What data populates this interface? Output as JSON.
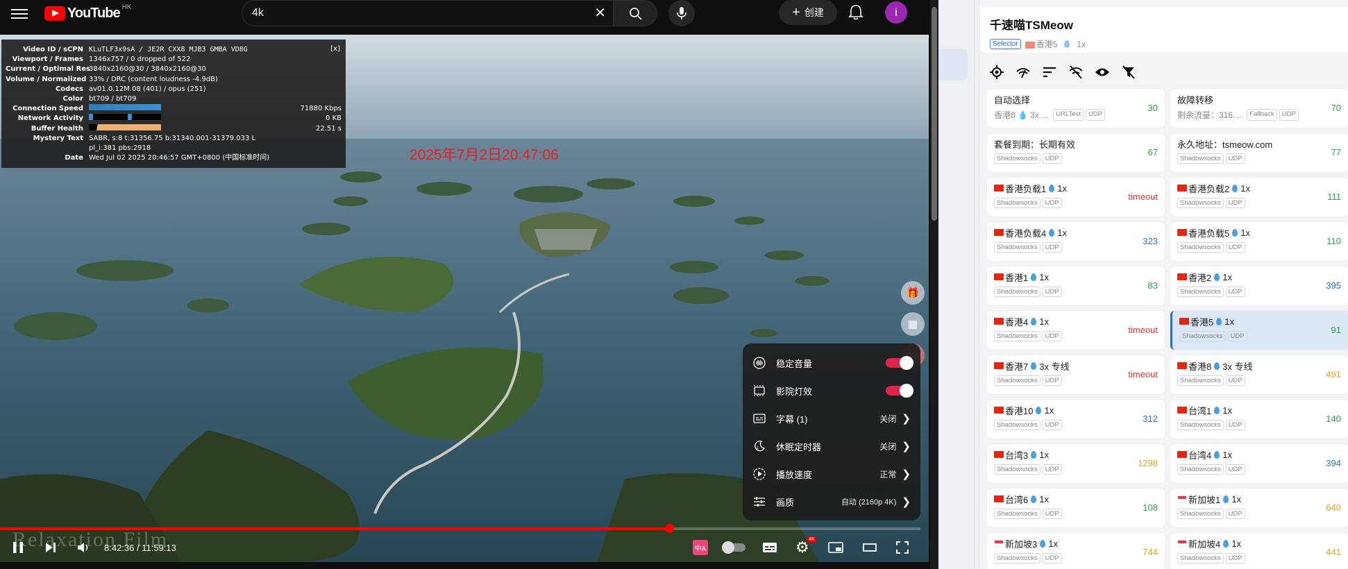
{
  "youtube": {
    "logo_text": "YouTube",
    "region": "HK",
    "search_value": "4k",
    "clear_glyph": "✕",
    "create_label": "创建",
    "avatar_letter": "i",
    "timestamp_overlay": "2025年7月2日20:47:06",
    "watermark": "Relaxation Film",
    "stats": {
      "close": "[x]",
      "rows": [
        {
          "label": "Video ID / sCPN",
          "value": "KLuTLF3x9sA / JE2R CXX8 MJB3 GMBA VD8G"
        },
        {
          "label": "Viewport / Frames",
          "value": "1346x757 / 0 dropped of 522"
        },
        {
          "label": "Current / Optimal Res",
          "value": "3840x2160@30 / 3840x2160@30"
        },
        {
          "label": "Volume / Normalized",
          "value": "33% / DRC (content loudness -4.9dB)"
        },
        {
          "label": "Codecs",
          "value": "av01.0.12M.08 (401) / opus (251)"
        },
        {
          "label": "Color",
          "value": "bt709 / bt709"
        },
        {
          "label": "Connection Speed",
          "value": "71880 Kbps"
        },
        {
          "label": "Network Activity",
          "value": "0 KB"
        },
        {
          "label": "Buffer Health",
          "value": "22.51 s"
        },
        {
          "label": "Mystery Text",
          "value": "SABR, s:8 t:31356.75 b:31340.001-31379.033 L"
        },
        {
          "label": "",
          "value": "pl_i:381 pbs:2918"
        },
        {
          "label": "Date",
          "value": "Wed Jul 02 2025 20:46:57 GMT+0800 (中国标准时间)"
        }
      ]
    },
    "settings": [
      {
        "label": "稳定音量",
        "value": "",
        "toggle": true
      },
      {
        "label": "影院灯效",
        "value": "",
        "toggle": true
      },
      {
        "label": "字幕 (1)",
        "value": "关闭"
      },
      {
        "label": "休眠定时器",
        "value": "关闭"
      },
      {
        "label": "播放速度",
        "value": "正常"
      },
      {
        "label": "画质",
        "value": "自动 (2160p 4K)"
      }
    ],
    "player": {
      "time": "8:42:36 / 11:59:13",
      "progress": 0.727,
      "quality_badge": "4K"
    }
  },
  "clash": {
    "group_name": "千速喵TSMeow",
    "group_type": "Selector",
    "group_current": "香港5",
    "group_rate": "1x",
    "nodes": [
      {
        "name": "自动选择",
        "sub": "香港8 💧 3x ...",
        "tags": [
          "URLTest",
          "UDP"
        ],
        "latency": "30",
        "lc": "g",
        "flag": "none",
        "subline": true
      },
      {
        "name": "故障转移",
        "sub": "剩余流量：316....",
        "tags": [
          "Fallback",
          "UDP"
        ],
        "latency": "70",
        "lc": "g",
        "flag": "none",
        "subline": true
      },
      {
        "name": "套餐到期：长期有效",
        "tags": [
          "Shadowsocks",
          "UDP"
        ],
        "latency": "67",
        "lc": "g",
        "flag": "none"
      },
      {
        "name": "永久地址：tsmeow.com",
        "tags": [
          "Shadowsocks",
          "UDP"
        ],
        "latency": "77",
        "lc": "g",
        "flag": "none"
      },
      {
        "name": "香港负载1",
        "rate": "1x",
        "tags": [
          "Shadowsocks",
          "UDP"
        ],
        "latency": "timeout",
        "lc": "r",
        "flag": "cn"
      },
      {
        "name": "香港负载2",
        "rate": "1x",
        "tags": [
          "Shadowsocks",
          "UDP"
        ],
        "latency": "111",
        "lc": "g",
        "flag": "cn"
      },
      {
        "name": "香港负载4",
        "rate": "1x",
        "tags": [
          "Shadowsocks",
          "UDP"
        ],
        "latency": "323",
        "lc": "b",
        "flag": "cn"
      },
      {
        "name": "香港负载5",
        "rate": "1x",
        "tags": [
          "Shadowsocks",
          "UDP"
        ],
        "latency": "110",
        "lc": "g",
        "flag": "cn"
      },
      {
        "name": "香港1",
        "rate": "1x",
        "tags": [
          "Shadowsocks",
          "UDP"
        ],
        "latency": "83",
        "lc": "g",
        "flag": "cn"
      },
      {
        "name": "香港2",
        "rate": "1x",
        "tags": [
          "Shadowsocks",
          "UDP"
        ],
        "latency": "395",
        "lc": "b",
        "flag": "cn"
      },
      {
        "name": "香港4",
        "rate": "1x",
        "tags": [
          "Shadowsocks",
          "UDP"
        ],
        "latency": "timeout",
        "lc": "r",
        "flag": "cn"
      },
      {
        "name": "香港5",
        "rate": "1x",
        "tags": [
          "Shadowsocks",
          "UDP"
        ],
        "latency": "91",
        "lc": "g",
        "flag": "cn",
        "selected": true
      },
      {
        "name": "香港7",
        "rate": "3x 专线",
        "tags": [
          "Shadowsocks",
          "UDP"
        ],
        "latency": "timeout",
        "lc": "r",
        "flag": "cn"
      },
      {
        "name": "香港8",
        "rate": "3x 专线",
        "tags": [
          "Shadowsocks",
          "UDP"
        ],
        "latency": "491",
        "lc": "o",
        "flag": "cn"
      },
      {
        "name": "香港10",
        "rate": "1x",
        "tags": [
          "Shadowsocks",
          "UDP"
        ],
        "latency": "312",
        "lc": "b",
        "flag": "cn"
      },
      {
        "name": "台湾1",
        "rate": "1x",
        "tags": [
          "Shadowsocks",
          "UDP"
        ],
        "latency": "140",
        "lc": "g",
        "flag": "cn"
      },
      {
        "name": "台湾3",
        "rate": "1x",
        "tags": [
          "Shadowsocks",
          "UDP"
        ],
        "latency": "1298",
        "lc": "o",
        "flag": "cn"
      },
      {
        "name": "台湾4",
        "rate": "1x",
        "tags": [
          "Shadowsocks",
          "UDP"
        ],
        "latency": "394",
        "lc": "b",
        "flag": "cn"
      },
      {
        "name": "台湾6",
        "rate": "1x",
        "tags": [
          "Shadowsocks",
          "UDP"
        ],
        "latency": "108",
        "lc": "g",
        "flag": "cn"
      },
      {
        "name": "新加坡1",
        "rate": "1x",
        "tags": [
          "Shadowsocks",
          "UDP"
        ],
        "latency": "640",
        "lc": "o",
        "flag": "sg"
      },
      {
        "name": "新加坡3",
        "rate": "1x",
        "tags": [
          "Shadowsocks",
          "UDP"
        ],
        "latency": "744",
        "lc": "o",
        "flag": "sg"
      },
      {
        "name": "新加坡4",
        "rate": "1x",
        "tags": [
          "Shadowsocks",
          "UDP"
        ],
        "latency": "441",
        "lc": "o",
        "flag": "sg"
      }
    ]
  }
}
